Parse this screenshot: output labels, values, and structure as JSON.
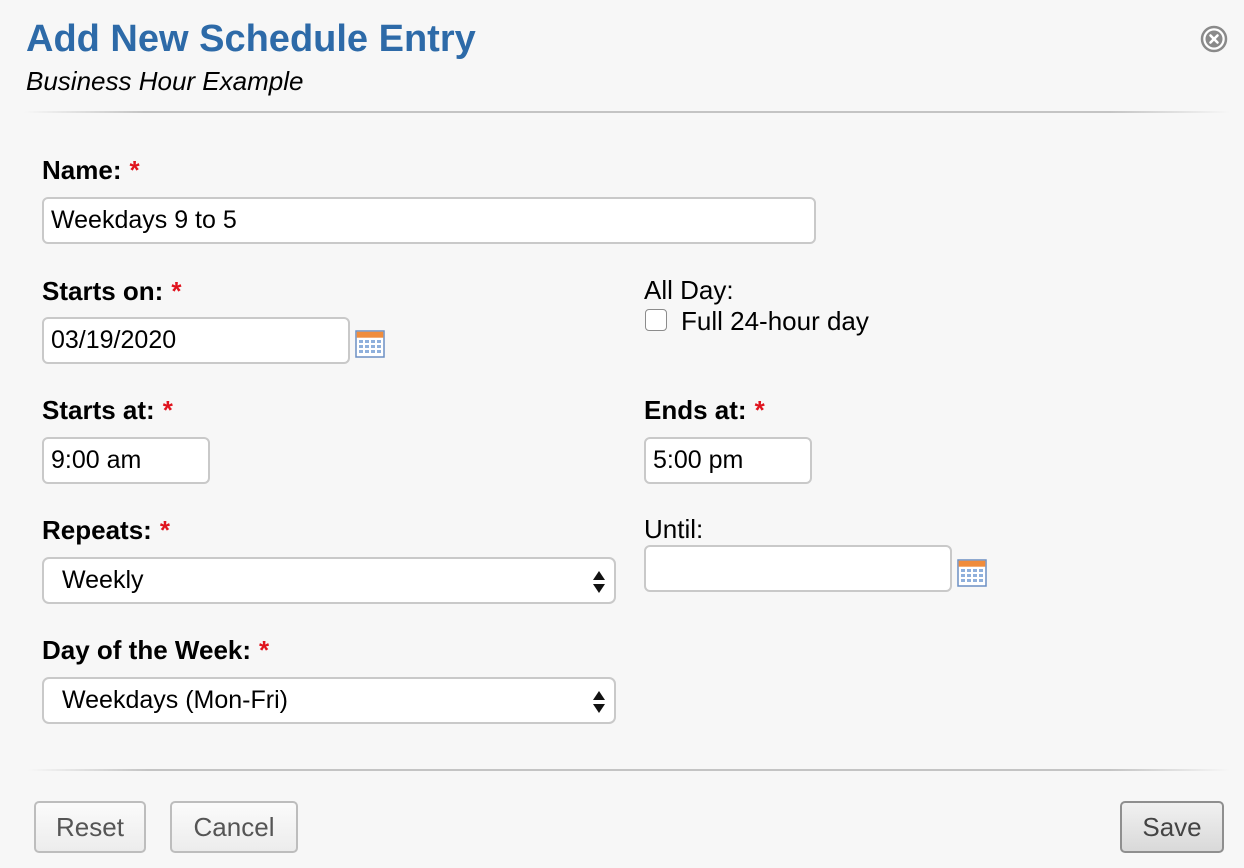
{
  "dialog": {
    "title": "Add New Schedule Entry",
    "subtitle": "Business Hour Example",
    "close_icon": "close-circle-icon"
  },
  "form": {
    "required_marker": "*",
    "name": {
      "label": "Name:",
      "value": "Weekdays 9 to 5"
    },
    "starts_on": {
      "label": "Starts on:",
      "value": "03/19/2020",
      "icon": "calendar-icon"
    },
    "all_day": {
      "label": "All Day:",
      "checkbox_label": "Full 24-hour day",
      "checked": false
    },
    "starts_at": {
      "label": "Starts at:",
      "value": "9:00 am"
    },
    "ends_at": {
      "label": "Ends at:",
      "value": "5:00 pm"
    },
    "repeats": {
      "label": "Repeats:",
      "selected": "Weekly"
    },
    "until": {
      "label": "Until:",
      "value": "",
      "icon": "calendar-icon"
    },
    "day_of_week": {
      "label": "Day of the Week:",
      "selected": "Weekdays (Mon-Fri)"
    }
  },
  "footer": {
    "reset_label": "Reset",
    "cancel_label": "Cancel",
    "save_label": "Save"
  },
  "colors": {
    "title": "#2d6aa8",
    "required": "#e0141e",
    "background": "#f7f7f7"
  }
}
